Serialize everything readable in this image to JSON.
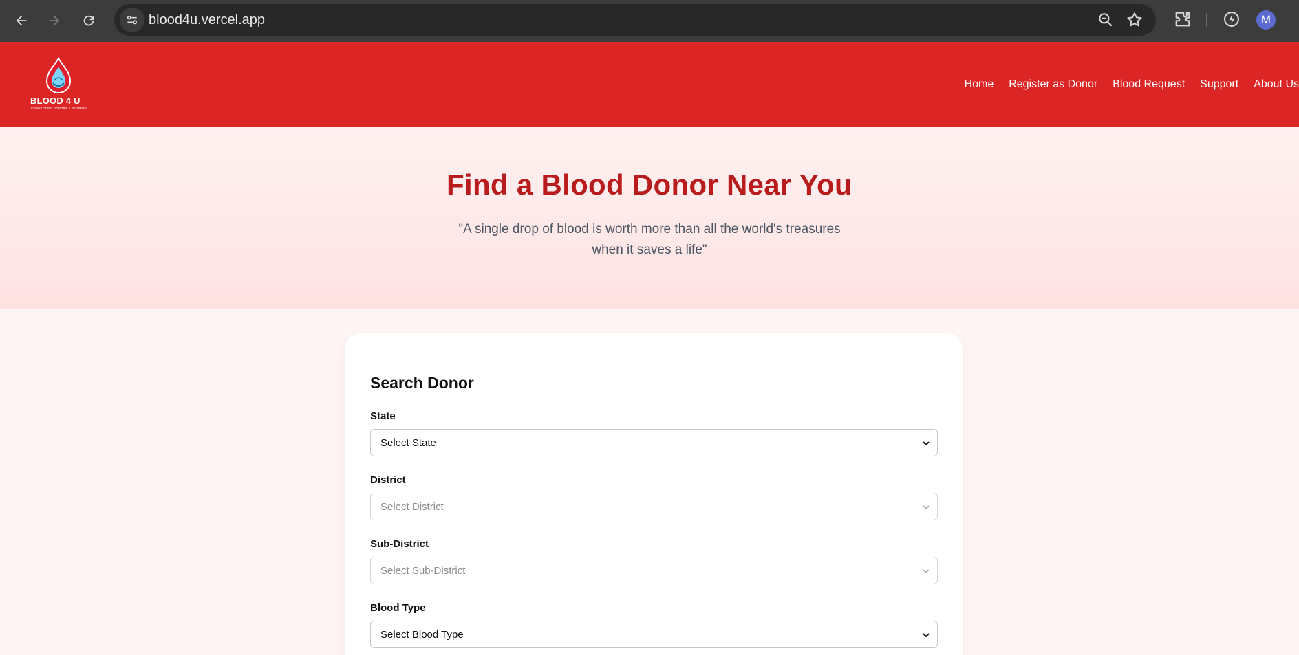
{
  "browser": {
    "url": "blood4u.vercel.app",
    "profile_initial": "M",
    "icons": [
      "back-icon",
      "forward-icon",
      "reload-icon",
      "site-info-icon",
      "zoom-icon",
      "bookmark-star-icon",
      "extensions-icon",
      "performance-icon"
    ]
  },
  "header": {
    "brand": "BLOOD 4 U",
    "tagline": "CONNECTING DONORS & PATIENTS",
    "accent_color": "#dc2626",
    "nav": [
      {
        "label": "Home"
      },
      {
        "label": "Register as Donor"
      },
      {
        "label": "Blood Request"
      },
      {
        "label": "Support"
      },
      {
        "label": "About Us"
      }
    ]
  },
  "hero": {
    "title": "Find a Blood Donor Near You",
    "quote": "\"A single drop of blood is worth more than all the world's treasures when it saves a life\"",
    "title_color": "#b91c1c"
  },
  "search": {
    "title": "Search Donor",
    "fields": [
      {
        "label": "State",
        "value": "Select State",
        "disabled": false
      },
      {
        "label": "District",
        "value": "Select District",
        "disabled": true
      },
      {
        "label": "Sub-District",
        "value": "Select Sub-District",
        "disabled": true
      },
      {
        "label": "Blood Type",
        "value": "Select Blood Type",
        "disabled": false
      }
    ]
  }
}
